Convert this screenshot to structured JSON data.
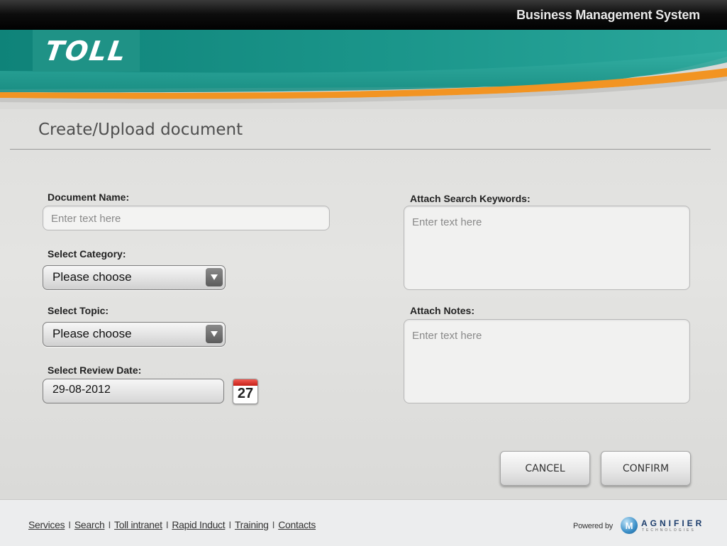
{
  "header": {
    "system_title": "Business Management System",
    "logo_text": "TOLL"
  },
  "colors": {
    "teal": "#1f9286",
    "orange": "#f29422",
    "dark_bar": "#000000"
  },
  "page": {
    "title": "Create/Upload document"
  },
  "form": {
    "document_name": {
      "label": "Document Name:",
      "placeholder": "Enter text here",
      "value": ""
    },
    "category": {
      "label": "Select Category:",
      "selected": "Please choose"
    },
    "topic": {
      "label": "Select Topic:",
      "selected": "Please choose"
    },
    "review_date": {
      "label": "Select Review Date:",
      "value": "29-08-2012",
      "calendar_day": "27"
    },
    "keywords": {
      "label": "Attach Search Keywords:",
      "placeholder": "Enter text here"
    },
    "notes": {
      "label": "Attach Notes:",
      "placeholder": "Enter text here"
    }
  },
  "actions": {
    "cancel_label": "CANCEL",
    "confirm_label": "CONFIRM"
  },
  "footer": {
    "links": [
      "Services",
      "Search",
      "Toll intranet",
      "Rapid Induct",
      "Training",
      "Contacts"
    ],
    "powered_by": "Powered by",
    "brand": "AGNIFIER",
    "brand_sub": "TECHNOLOGIES"
  }
}
